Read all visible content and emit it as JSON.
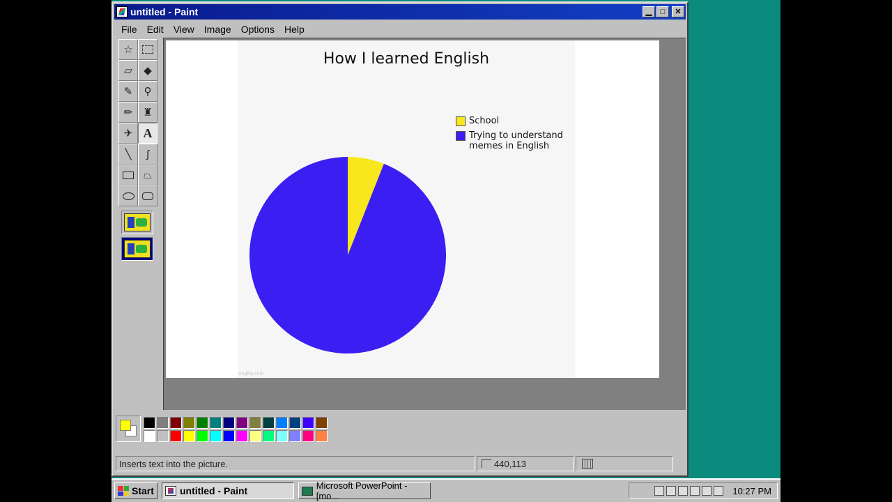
{
  "window": {
    "title": "untitled - Paint"
  },
  "menu": [
    "File",
    "Edit",
    "View",
    "Image",
    "Options",
    "Help"
  ],
  "tools": [
    {
      "name": "free-select-icon"
    },
    {
      "name": "rect-select-icon"
    },
    {
      "name": "eraser-icon"
    },
    {
      "name": "fill-bucket-icon"
    },
    {
      "name": "color-picker-icon"
    },
    {
      "name": "magnifier-icon"
    },
    {
      "name": "pencil-icon"
    },
    {
      "name": "brush-icon"
    },
    {
      "name": "airbrush-icon"
    },
    {
      "name": "text-icon"
    },
    {
      "name": "line-icon"
    },
    {
      "name": "curve-icon"
    },
    {
      "name": "rectangle-icon"
    },
    {
      "name": "polygon-icon"
    },
    {
      "name": "ellipse-icon"
    },
    {
      "name": "rounded-rectangle-icon"
    }
  ],
  "chart_data": {
    "type": "pie",
    "title": "How I learned English",
    "categories": [
      "School",
      "Trying to understand memes in English"
    ],
    "values": [
      6,
      94
    ],
    "colors": [
      "#f8e71c",
      "#3a1ef2"
    ],
    "legend": "top-right",
    "watermark": "imgflip.com"
  },
  "palette": {
    "foreground": "#ffff00",
    "background": "#ffffff",
    "colors": [
      "#000000",
      "#808080",
      "#800000",
      "#808000",
      "#008000",
      "#008080",
      "#000080",
      "#800080",
      "#808040",
      "#004040",
      "#0080ff",
      "#004080",
      "#4000ff",
      "#804000",
      "#ffffff",
      "#c0c0c0",
      "#ff0000",
      "#ffff00",
      "#00ff00",
      "#00ffff",
      "#0000ff",
      "#ff00ff",
      "#ffff80",
      "#00ff80",
      "#80ffff",
      "#8080ff",
      "#ff0080",
      "#ff8040"
    ]
  },
  "status": {
    "help_text": "Inserts text into the picture.",
    "position": "440,113",
    "size": ""
  },
  "taskbar": {
    "start": "Start",
    "tasks": [
      "untitled - Paint",
      "Microsoft PowerPoint - [mo..."
    ],
    "clock": "10:27 PM"
  }
}
